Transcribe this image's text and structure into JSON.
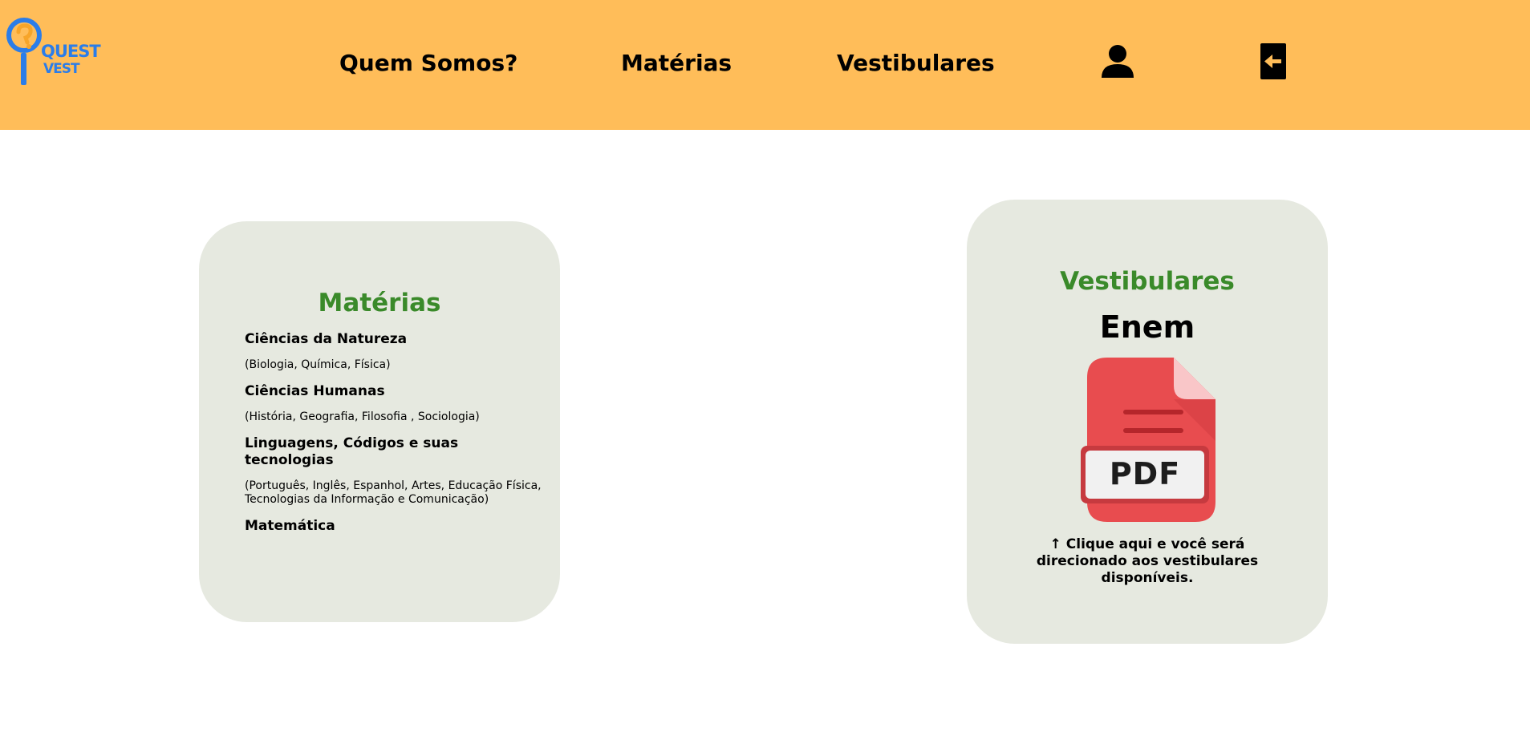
{
  "logo": {
    "line1": "QUEST",
    "line2": "VEST",
    "icon": "magnifier-question-icon",
    "colors": {
      "blue": "#2b7de9",
      "orange": "#f7a52a"
    }
  },
  "nav": {
    "items": [
      {
        "label": "Quem Somos?"
      },
      {
        "label": "Matérias"
      },
      {
        "label": "Vestibulares"
      }
    ],
    "user_icon": "user-icon",
    "exit_icon": "exit-icon"
  },
  "subjects_card": {
    "title": "Matérias",
    "areas": [
      {
        "name": "Ciências da Natureza",
        "list": "(Biologia, Química, Física)"
      },
      {
        "name": "Ciências Humanas",
        "list": "(História, Geografia, Filosofia , Sociologia)"
      },
      {
        "name": "Linguagens, Códigos e suas tecnologias",
        "list": "(Português, Inglês, Espanhol, Artes, Educação Física, Tecnologias da Informação e Comunicação)"
      },
      {
        "name": "Matemática"
      }
    ]
  },
  "exams_card": {
    "title": "Vestibulares",
    "exam": "Enem",
    "pdf_label": "PDF",
    "pdf_icon": "pdf-file-icon",
    "caption": "↑ Clique aqui e você será direcionado aos vestibulares disponíveis."
  },
  "colors": {
    "header_bg": "#ffbd59",
    "card_bg": "#e6e9e0",
    "title_green": "#3a8a2a",
    "pdf_red": "#e84c4f"
  }
}
